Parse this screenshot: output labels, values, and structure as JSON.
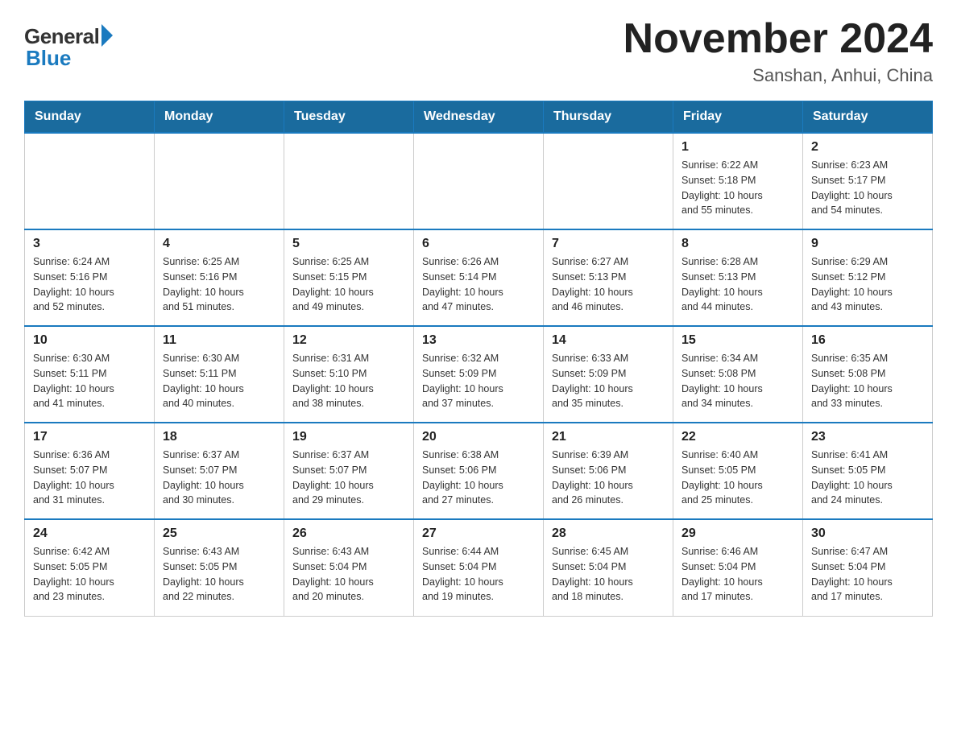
{
  "logo": {
    "general": "General",
    "blue": "Blue"
  },
  "header": {
    "title": "November 2024",
    "subtitle": "Sanshan, Anhui, China"
  },
  "days_of_week": [
    "Sunday",
    "Monday",
    "Tuesday",
    "Wednesday",
    "Thursday",
    "Friday",
    "Saturday"
  ],
  "weeks": [
    [
      {
        "day": "",
        "info": ""
      },
      {
        "day": "",
        "info": ""
      },
      {
        "day": "",
        "info": ""
      },
      {
        "day": "",
        "info": ""
      },
      {
        "day": "",
        "info": ""
      },
      {
        "day": "1",
        "info": "Sunrise: 6:22 AM\nSunset: 5:18 PM\nDaylight: 10 hours\nand 55 minutes."
      },
      {
        "day": "2",
        "info": "Sunrise: 6:23 AM\nSunset: 5:17 PM\nDaylight: 10 hours\nand 54 minutes."
      }
    ],
    [
      {
        "day": "3",
        "info": "Sunrise: 6:24 AM\nSunset: 5:16 PM\nDaylight: 10 hours\nand 52 minutes."
      },
      {
        "day": "4",
        "info": "Sunrise: 6:25 AM\nSunset: 5:16 PM\nDaylight: 10 hours\nand 51 minutes."
      },
      {
        "day": "5",
        "info": "Sunrise: 6:25 AM\nSunset: 5:15 PM\nDaylight: 10 hours\nand 49 minutes."
      },
      {
        "day": "6",
        "info": "Sunrise: 6:26 AM\nSunset: 5:14 PM\nDaylight: 10 hours\nand 47 minutes."
      },
      {
        "day": "7",
        "info": "Sunrise: 6:27 AM\nSunset: 5:13 PM\nDaylight: 10 hours\nand 46 minutes."
      },
      {
        "day": "8",
        "info": "Sunrise: 6:28 AM\nSunset: 5:13 PM\nDaylight: 10 hours\nand 44 minutes."
      },
      {
        "day": "9",
        "info": "Sunrise: 6:29 AM\nSunset: 5:12 PM\nDaylight: 10 hours\nand 43 minutes."
      }
    ],
    [
      {
        "day": "10",
        "info": "Sunrise: 6:30 AM\nSunset: 5:11 PM\nDaylight: 10 hours\nand 41 minutes."
      },
      {
        "day": "11",
        "info": "Sunrise: 6:30 AM\nSunset: 5:11 PM\nDaylight: 10 hours\nand 40 minutes."
      },
      {
        "day": "12",
        "info": "Sunrise: 6:31 AM\nSunset: 5:10 PM\nDaylight: 10 hours\nand 38 minutes."
      },
      {
        "day": "13",
        "info": "Sunrise: 6:32 AM\nSunset: 5:09 PM\nDaylight: 10 hours\nand 37 minutes."
      },
      {
        "day": "14",
        "info": "Sunrise: 6:33 AM\nSunset: 5:09 PM\nDaylight: 10 hours\nand 35 minutes."
      },
      {
        "day": "15",
        "info": "Sunrise: 6:34 AM\nSunset: 5:08 PM\nDaylight: 10 hours\nand 34 minutes."
      },
      {
        "day": "16",
        "info": "Sunrise: 6:35 AM\nSunset: 5:08 PM\nDaylight: 10 hours\nand 33 minutes."
      }
    ],
    [
      {
        "day": "17",
        "info": "Sunrise: 6:36 AM\nSunset: 5:07 PM\nDaylight: 10 hours\nand 31 minutes."
      },
      {
        "day": "18",
        "info": "Sunrise: 6:37 AM\nSunset: 5:07 PM\nDaylight: 10 hours\nand 30 minutes."
      },
      {
        "day": "19",
        "info": "Sunrise: 6:37 AM\nSunset: 5:07 PM\nDaylight: 10 hours\nand 29 minutes."
      },
      {
        "day": "20",
        "info": "Sunrise: 6:38 AM\nSunset: 5:06 PM\nDaylight: 10 hours\nand 27 minutes."
      },
      {
        "day": "21",
        "info": "Sunrise: 6:39 AM\nSunset: 5:06 PM\nDaylight: 10 hours\nand 26 minutes."
      },
      {
        "day": "22",
        "info": "Sunrise: 6:40 AM\nSunset: 5:05 PM\nDaylight: 10 hours\nand 25 minutes."
      },
      {
        "day": "23",
        "info": "Sunrise: 6:41 AM\nSunset: 5:05 PM\nDaylight: 10 hours\nand 24 minutes."
      }
    ],
    [
      {
        "day": "24",
        "info": "Sunrise: 6:42 AM\nSunset: 5:05 PM\nDaylight: 10 hours\nand 23 minutes."
      },
      {
        "day": "25",
        "info": "Sunrise: 6:43 AM\nSunset: 5:05 PM\nDaylight: 10 hours\nand 22 minutes."
      },
      {
        "day": "26",
        "info": "Sunrise: 6:43 AM\nSunset: 5:04 PM\nDaylight: 10 hours\nand 20 minutes."
      },
      {
        "day": "27",
        "info": "Sunrise: 6:44 AM\nSunset: 5:04 PM\nDaylight: 10 hours\nand 19 minutes."
      },
      {
        "day": "28",
        "info": "Sunrise: 6:45 AM\nSunset: 5:04 PM\nDaylight: 10 hours\nand 18 minutes."
      },
      {
        "day": "29",
        "info": "Sunrise: 6:46 AM\nSunset: 5:04 PM\nDaylight: 10 hours\nand 17 minutes."
      },
      {
        "day": "30",
        "info": "Sunrise: 6:47 AM\nSunset: 5:04 PM\nDaylight: 10 hours\nand 17 minutes."
      }
    ]
  ]
}
